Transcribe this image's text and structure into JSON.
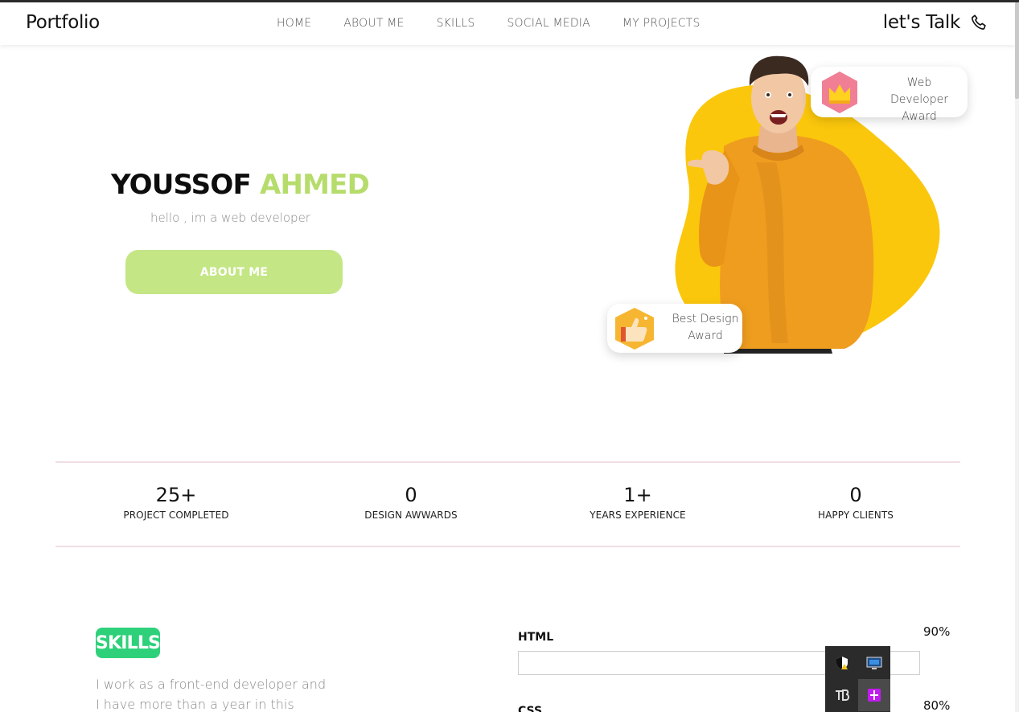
{
  "navbar": {
    "brand": "Portfolio",
    "links": [
      "HOME",
      "ABOUT ME",
      "SKILLS",
      "SOCIAL MEDIA",
      "MY PROJECTS"
    ],
    "cta": "let's Talk",
    "cta_icon": "phone-icon"
  },
  "hero": {
    "first_name": "YOUSSOF",
    "last_name": "AHMED",
    "subtitle": "hello , im a web developer",
    "button_label": "ABOUT ME",
    "accent_color": "#b6dc6c",
    "blob_color": "#fbc70c"
  },
  "awards": [
    {
      "label": "Web Developer Award",
      "icon": "crown-icon"
    },
    {
      "label": "Best Design Award",
      "icon": "thumbs-up-icon"
    }
  ],
  "stats": [
    {
      "value": "25+",
      "label": "PROJECT COMPLETED"
    },
    {
      "value": "0",
      "label": "DESIGN AWWARDS"
    },
    {
      "value": "1+",
      "label": "YEARS EXPERIENCE"
    },
    {
      "value": "0",
      "label": "HAPPY CLIENTS"
    }
  ],
  "skills_section": {
    "badge": "SKILLS",
    "description": "I work as a front-end developer and I have more than a year in this",
    "badge_color": "#2ed17a",
    "items": [
      {
        "name": "HTML",
        "percent_label": "90%",
        "level": 0.9
      },
      {
        "name": "CSS",
        "percent_label": "80%",
        "level": 0.8
      }
    ]
  },
  "system_tray": {
    "icons": [
      "shield-warning-icon",
      "monitor-icon",
      "tb-app-icon",
      "purple-app-icon"
    ]
  }
}
